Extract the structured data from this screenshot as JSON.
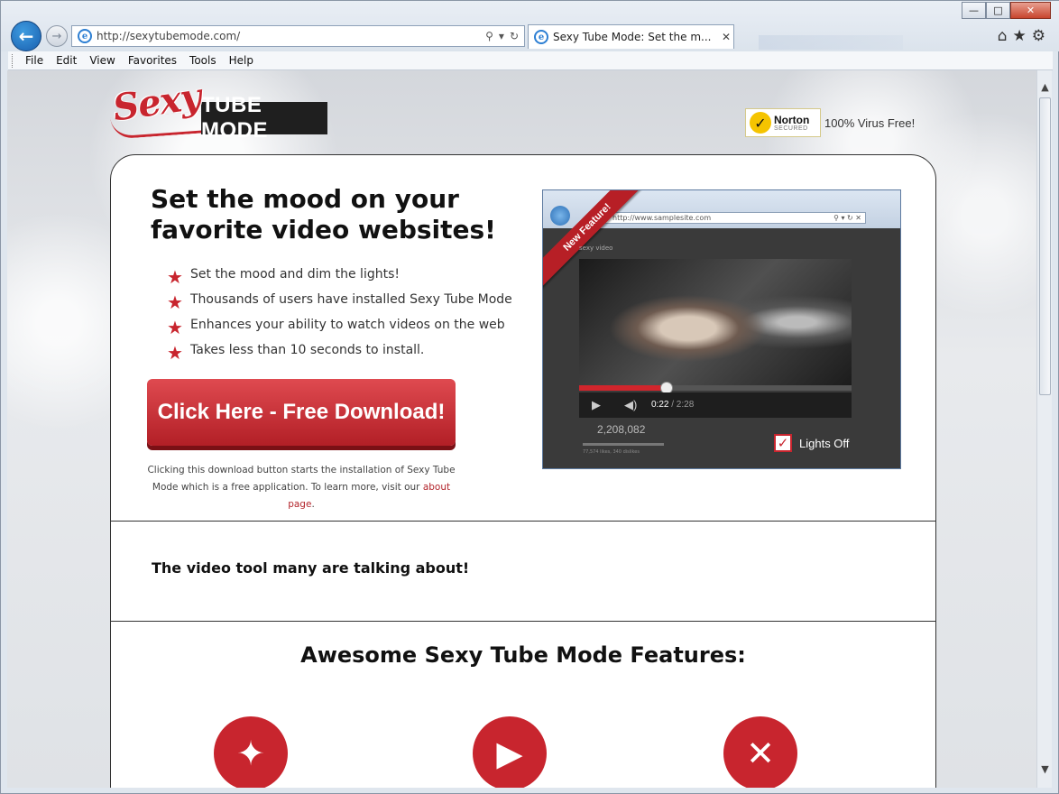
{
  "browser": {
    "url": "http://sexytubemode.com/",
    "tab_title": "Sexy Tube Mode: Set the m...",
    "window_controls": {
      "minimize": "—",
      "maximize": "□",
      "close": "✕"
    },
    "menu": [
      "File",
      "Edit",
      "View",
      "Favorites",
      "Tools",
      "Help"
    ]
  },
  "header": {
    "logo_script": "Sexy",
    "logo_box": "TUBE MODE",
    "norton_name": "Norton",
    "norton_sub": "SECURED",
    "virus_free": "100% Virus Free!"
  },
  "hero": {
    "title": "Set the mood on your favorite video websites!",
    "bullets": [
      "Set the mood and dim the lights!",
      "Thousands of users have installed Sexy Tube Mode",
      "Enhances your ability to watch videos on the web",
      "Takes less than 10 seconds to install."
    ],
    "download_label": "Click Here - Free Download!",
    "disclaimer_text": "Clicking this download button starts the installation of Sexy Tube Mode which is a free application. To learn more, visit our",
    "disclaimer_link": "about page",
    "disclaimer_end": "."
  },
  "preview": {
    "ribbon": "New Feature!",
    "url": "http://www.samplesite.com",
    "search_label": "sexy video",
    "current_time": "0:22",
    "total_time": "/ 2:28",
    "progress": 0.32,
    "views": "2,208,082",
    "likes": "77,574 likes, 340 dislikes",
    "lights_off": "Lights Off"
  },
  "sections": {
    "talking": "The video tool many are talking about!",
    "features_title": "Awesome Sexy Tube Mode Features:"
  },
  "colors": {
    "accent": "#c8252e",
    "link": "#b3252c"
  }
}
